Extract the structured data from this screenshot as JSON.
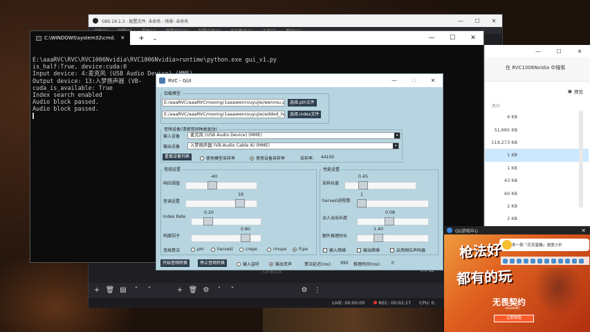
{
  "obs": {
    "title": "OBS 29.1.3 - 配置文件: 未命名 - 场景: 未命名",
    "menu": [
      "文件(F)",
      "编辑(E)",
      "视图(V)",
      "停靠窗口(D)",
      "配置文件(P)",
      "场景集合(S)",
      "工具(T)",
      "帮助(H)"
    ],
    "mixer_label": "入步麦克风",
    "mixer_db": "0.0 dB",
    "live": "LIVE: 00:00:00",
    "rec": "REC: 00:02:17",
    "cpu": "CPU: 0."
  },
  "explorer": {
    "search_placeholder": "在 RVC1006Nvidia 中搜索",
    "preview_label": "预览",
    "size_header": "大小",
    "sizes": [
      "6 KB",
      "51,685 KB",
      "119,273 KB",
      "1 KB",
      "1 KB",
      "43 KB",
      "60 KB",
      "2 KB",
      "2 KB"
    ]
  },
  "cmd": {
    "tab_title": "C:\\WINDOWS\\system32\\cmd.",
    "lines": [
      "E:\\aaaRVC\\RVC\\RVC1006Nvidia\\RVC1006Nvidia>runtime\\python.exe gui_v1.py",
      "is_half:True, device:cuda:0",
      "Input device: 4:麦克风 (USB Audio Device) (MME)",
      "Output device: 13:入梦扬声器 (VB-",
      "cuda_is_available: True",
      "Index search enabled",
      "Audio block passed.",
      "Audio block passed."
    ]
  },
  "rvc": {
    "title": "RVC - GUI",
    "load_model_label": "加载模型",
    "pth_path": "E:/aaaRVC/aaaRVCmoxing/1aaawenrouyujie/wenrou.p",
    "index_path": "E:/aaaRVC/aaaRVCmoxing/1aaawenrouyujie/added_IV",
    "pth_btn": "选择.pth文件",
    "index_btn": "选择.index文件",
    "audio_device_label": "音频设备(请使用同种类驱动)",
    "input_device_label": "输入设备",
    "input_device_value": "麦克风 (USB Audio Device) (MME)",
    "output_device_label": "输出设备",
    "output_device_value": "入梦扬声器 (VB-Audio Cable A) (MME)",
    "reload_btn": "重载设备列表",
    "model_sr_label": "使用模型采样率",
    "device_sr_label": "使用设备采样率",
    "sample_rate_label": "采样率:",
    "sample_rate_value": "44100",
    "general_label": "常规设置",
    "perf_label": "性能设置",
    "sliders": {
      "threshold_label": "响应阈值",
      "threshold_value": "-40",
      "pitch_label": "音调设置",
      "pitch_value": "16",
      "index_rate_label": "Index Rate",
      "index_rate_value": "0.20",
      "rms_label": "响度因子",
      "rms_value": "0.80",
      "block_label": "采样长度",
      "block_value": "0.45",
      "harvest_label": "harvest进程数",
      "harvest_value": "1",
      "crossfade_label": "淡入淡出长度",
      "crossfade_value": "0.08",
      "extra_label": "额外推理时长",
      "extra_value": "1.40"
    },
    "f0_label": "音高算法",
    "f0_methods": [
      "pm",
      "harvest",
      "crepe",
      "rmvpe",
      "fcpe"
    ],
    "checks": [
      "输入降噪",
      "输出降噪",
      "启用相位声码器"
    ],
    "start_btn": "开始音频转换",
    "stop_btn": "停止音频转换",
    "monitor_in": "输入监听",
    "monitor_out": "输出变声",
    "latency_label": "算法延迟(ms):",
    "latency_value": "990",
    "infer_time_label": "推理时间(ms):",
    "infer_time_value": "0"
  },
  "ad": {
    "app": "QQ游戏中心",
    "bubble": "来一款「花花蜜糖」速度小抄",
    "title1": "枪法好",
    "title2": "都有的玩",
    "brand": "无畏契约",
    "brand_sub": "VALORANT",
    "button": "立即体验"
  }
}
